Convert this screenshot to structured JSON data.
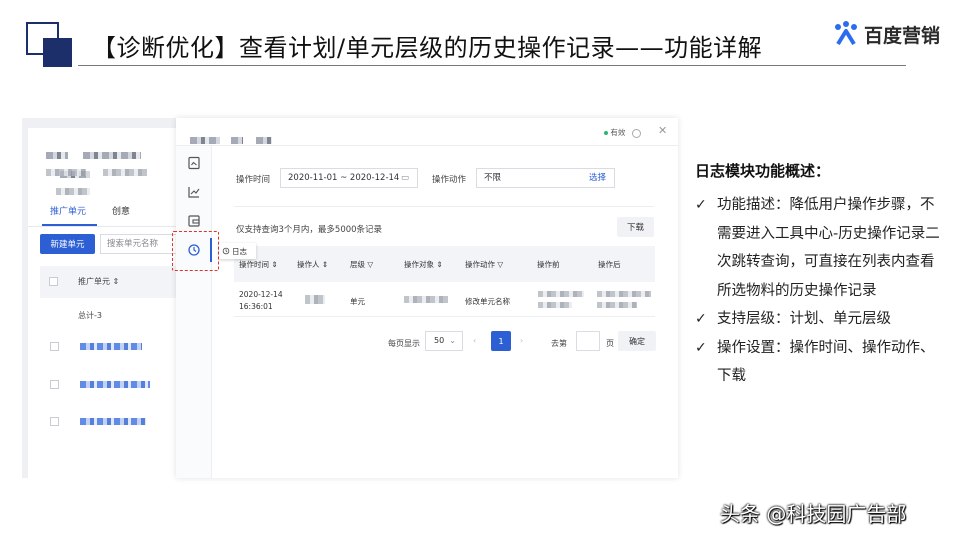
{
  "slide": {
    "title": "【诊断优化】查看计划/单元层级的历史操作记录——功能详解",
    "brand": "百度营销"
  },
  "back_panel": {
    "tabs": [
      "推广单元",
      "创意"
    ],
    "new_button": "新建单元",
    "search_placeholder": "搜索单元名称",
    "column_unit": "推广单元 ⇕",
    "total_label": "总计-3"
  },
  "dialog": {
    "status": "有效",
    "close_symbol": "✕",
    "tooltip": "日志",
    "filters": {
      "time_label": "操作时间",
      "time_value": "2020-11-01 ~ 2020-12-14",
      "action_label": "操作动作",
      "action_value": "不限",
      "action_pick": "选择"
    },
    "hint": "仅支持查询3个月内，最多5000条记录",
    "download": "下载",
    "columns": [
      "操作时间 ⇕",
      "操作人 ⇕",
      "层级 ▽",
      "操作对象 ⇕",
      "操作动作 ▽",
      "操作前",
      "操作后"
    ],
    "row": {
      "date": "2020-12-14",
      "time": "16:36:01",
      "level": "单元",
      "action": "修改单元名称"
    },
    "pagination": {
      "per_page_label": "每页显示",
      "per_page_value": "50",
      "current_page": "1",
      "goto_label": "去第",
      "page_unit": "页",
      "confirm": "确定"
    }
  },
  "overview": {
    "title": "日志模块功能概述：",
    "items": [
      "功能描述：降低用户操作步骤，不需要进入工具中心-历史操作记录二次跳转查询，可直接在列表内查看所选物料的历史操作记录",
      "支持层级：计划、单元层级",
      "操作设置：操作时间、操作动作、下载"
    ]
  },
  "watermark": "头条 @科技园广告部",
  "colors": {
    "navy": "#1c2f6b",
    "accent_blue": "#2c5fd4",
    "highlight_red": "#d33333"
  }
}
